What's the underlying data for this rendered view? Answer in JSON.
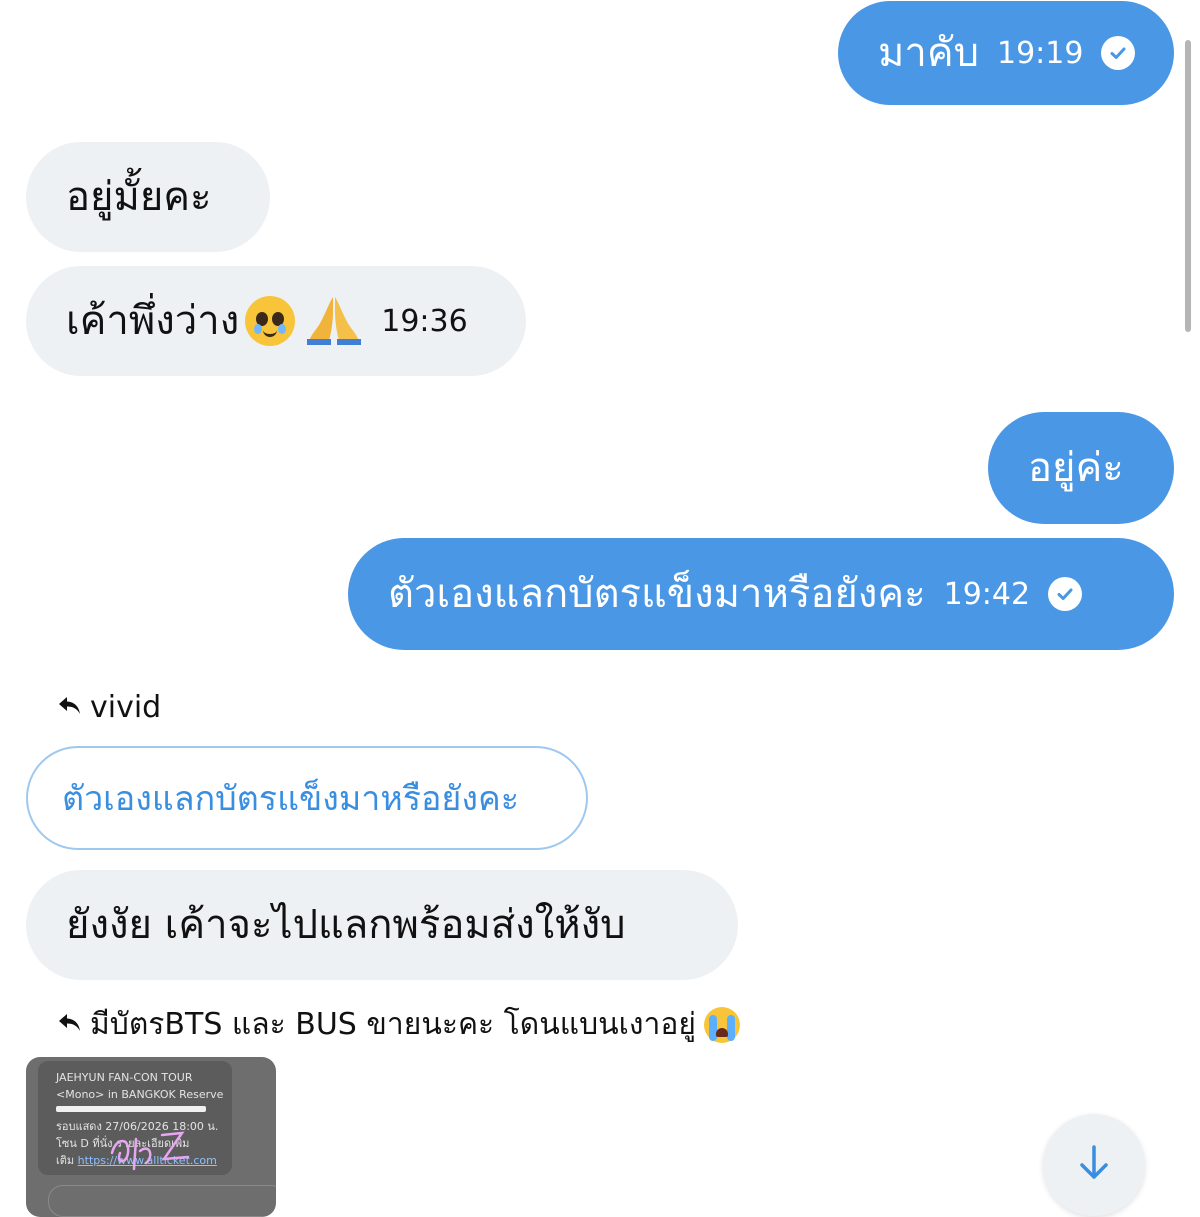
{
  "colors": {
    "outgoing": "#4a97e6",
    "incoming": "#eef1f4",
    "quote_text": "#3a8ee0"
  },
  "messages": [
    {
      "text": "มาคับ",
      "time": "19:19",
      "status": "read-check-icon"
    },
    {
      "text": "อยู่มั้ยคะ"
    },
    {
      "text": "เค้าพึ่งว่าง",
      "emojis": [
        "pleading-face-emoji",
        "folded-hands-emoji"
      ],
      "time": "19:36"
    },
    {
      "text": "อยู่ค่ะ"
    },
    {
      "text": "ตัวเองแลกบัตรแข็งมาหรือยังคะ",
      "time": "19:42",
      "status": "read-check-icon"
    },
    {
      "reply_to": "vivid",
      "quote": "ตัวเองแลกบัตรแข็งมาหรือยังคะ"
    },
    {
      "text": "ยังงัย เค้าจะไปแลกพร้อมส่งให้งับ"
    },
    {
      "reply_to": "มีบัตรBTS และ BUS ขายนะคะ โดนแบนเงาอยู่",
      "reply_emoji": "loudly-crying-face-emoji"
    }
  ],
  "attachment": {
    "line1": "JAEHYUN FAN-CON TOUR",
    "line2": "<Mono> in BANGKOK Reserve",
    "line3": "รอบแสดง 27/06/2026 18:00 น.",
    "line4": "โซน D ที่นั่ง",
    "line4b": "รายละเอียดเพิ่ม",
    "line5": "เติม",
    "link": "https://www.allticket.com"
  },
  "scroll_down_icon": "arrow-down-icon"
}
